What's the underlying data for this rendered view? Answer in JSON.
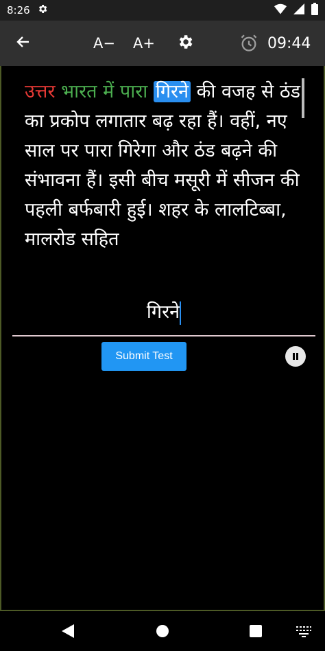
{
  "status_bar": {
    "time": "8:26"
  },
  "toolbar": {
    "font_decrease_label": "A−",
    "font_increase_label": "A+",
    "timer": "09:44"
  },
  "passage": {
    "words": [
      {
        "text": "उत्तर",
        "state": "wrong"
      },
      {
        "text": "भारत",
        "state": "right"
      },
      {
        "text": "में",
        "state": "right"
      },
      {
        "text": "पारा",
        "state": "right"
      },
      {
        "text": "गिरने",
        "state": "current"
      },
      {
        "text": "की",
        "state": "pending"
      },
      {
        "text": "वजह",
        "state": "pending"
      },
      {
        "text": "से",
        "state": "pending"
      },
      {
        "text": "ठंड",
        "state": "pending"
      },
      {
        "text": "का",
        "state": "pending"
      },
      {
        "text": "प्रकोप",
        "state": "pending"
      },
      {
        "text": "लगातार",
        "state": "pending"
      },
      {
        "text": "बढ़",
        "state": "pending"
      },
      {
        "text": "रहा",
        "state": "pending"
      },
      {
        "text": "हैं।",
        "state": "pending"
      },
      {
        "text": "वहीं,",
        "state": "pending"
      },
      {
        "text": "नए",
        "state": "pending"
      },
      {
        "text": "साल",
        "state": "pending"
      },
      {
        "text": "पर",
        "state": "pending"
      },
      {
        "text": "पारा",
        "state": "pending"
      },
      {
        "text": "गिरेगा",
        "state": "pending"
      },
      {
        "text": "और",
        "state": "pending"
      },
      {
        "text": "ठंड",
        "state": "pending"
      },
      {
        "text": "बढ़ने",
        "state": "pending"
      },
      {
        "text": "की",
        "state": "pending"
      },
      {
        "text": "संभावना",
        "state": "pending"
      },
      {
        "text": "हैं।",
        "state": "pending"
      },
      {
        "text": "इसी",
        "state": "pending"
      },
      {
        "text": "बीच",
        "state": "pending"
      },
      {
        "text": "मसूरी",
        "state": "pending"
      },
      {
        "text": "में",
        "state": "pending"
      },
      {
        "text": "सीजन",
        "state": "pending"
      },
      {
        "text": "की",
        "state": "pending"
      },
      {
        "text": "पहली",
        "state": "pending"
      },
      {
        "text": "बर्फबारी",
        "state": "pending"
      },
      {
        "text": "हुई।",
        "state": "pending"
      },
      {
        "text": "शहर",
        "state": "pending"
      },
      {
        "text": "के",
        "state": "pending"
      },
      {
        "text": "लालटिब्बा,",
        "state": "pending"
      },
      {
        "text": "मालरोड",
        "state": "pending"
      },
      {
        "text": "सहित",
        "state": "pending"
      }
    ],
    "colors": {
      "wrong": "#e53935",
      "right": "#4caf50",
      "current_bg": "#2a8ff0"
    }
  },
  "input": {
    "typed_text": "गिरने"
  },
  "actions": {
    "submit_label": "Submit Test"
  },
  "icons": {
    "status": [
      "gear-icon",
      "wifi-icon",
      "signal-icon",
      "battery-icon"
    ],
    "toolbar": [
      "back-arrow-icon",
      "settings-gear-icon",
      "alarm-clock-icon"
    ],
    "nav": [
      "back-triangle-icon",
      "home-circle-icon",
      "recents-square-icon",
      "keyboard-icon"
    ]
  }
}
